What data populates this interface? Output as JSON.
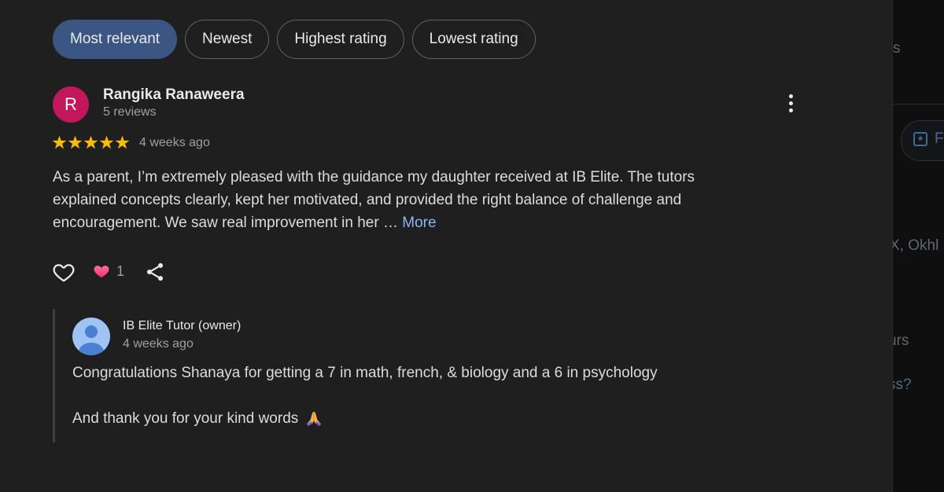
{
  "filters": [
    {
      "label": "Most relevant",
      "active": true
    },
    {
      "label": "Newest",
      "active": false
    },
    {
      "label": "Highest rating",
      "active": false
    },
    {
      "label": "Lowest rating",
      "active": false
    }
  ],
  "review": {
    "avatar_letter": "R",
    "avatar_color": "#c2185b",
    "reviewer_name": "Rangika Ranaweera",
    "reviewer_meta": "5 reviews",
    "rating": 5,
    "date": "4 weeks ago",
    "body_lines": [
      "As a parent, I’m extremely pleased with the guidance my daughter received at IB Elite. The tutors",
      "explained concepts clearly, kept her motivated, and provided the right balance of challenge and",
      "encouragement. We saw real improvement in her …"
    ],
    "more_label": "More",
    "reaction_count": "1"
  },
  "owner_reply": {
    "name": "IB Elite Tutor (owner)",
    "date": "4 weeks ago",
    "line1": "Congratulations Shanaya for getting a 7 in math, french, & biology and a 6 in psychology",
    "line2": "And thank you for your kind words"
  },
  "side_panel": {
    "frag1": "s",
    "frag2": "F",
    "frag3": "X, Okhl",
    "frag4": "urs",
    "frag5": "ss?"
  },
  "colors": {
    "accent_chip": "#3b5683",
    "link": "#8ab4f8",
    "star": "#fbbc04"
  }
}
